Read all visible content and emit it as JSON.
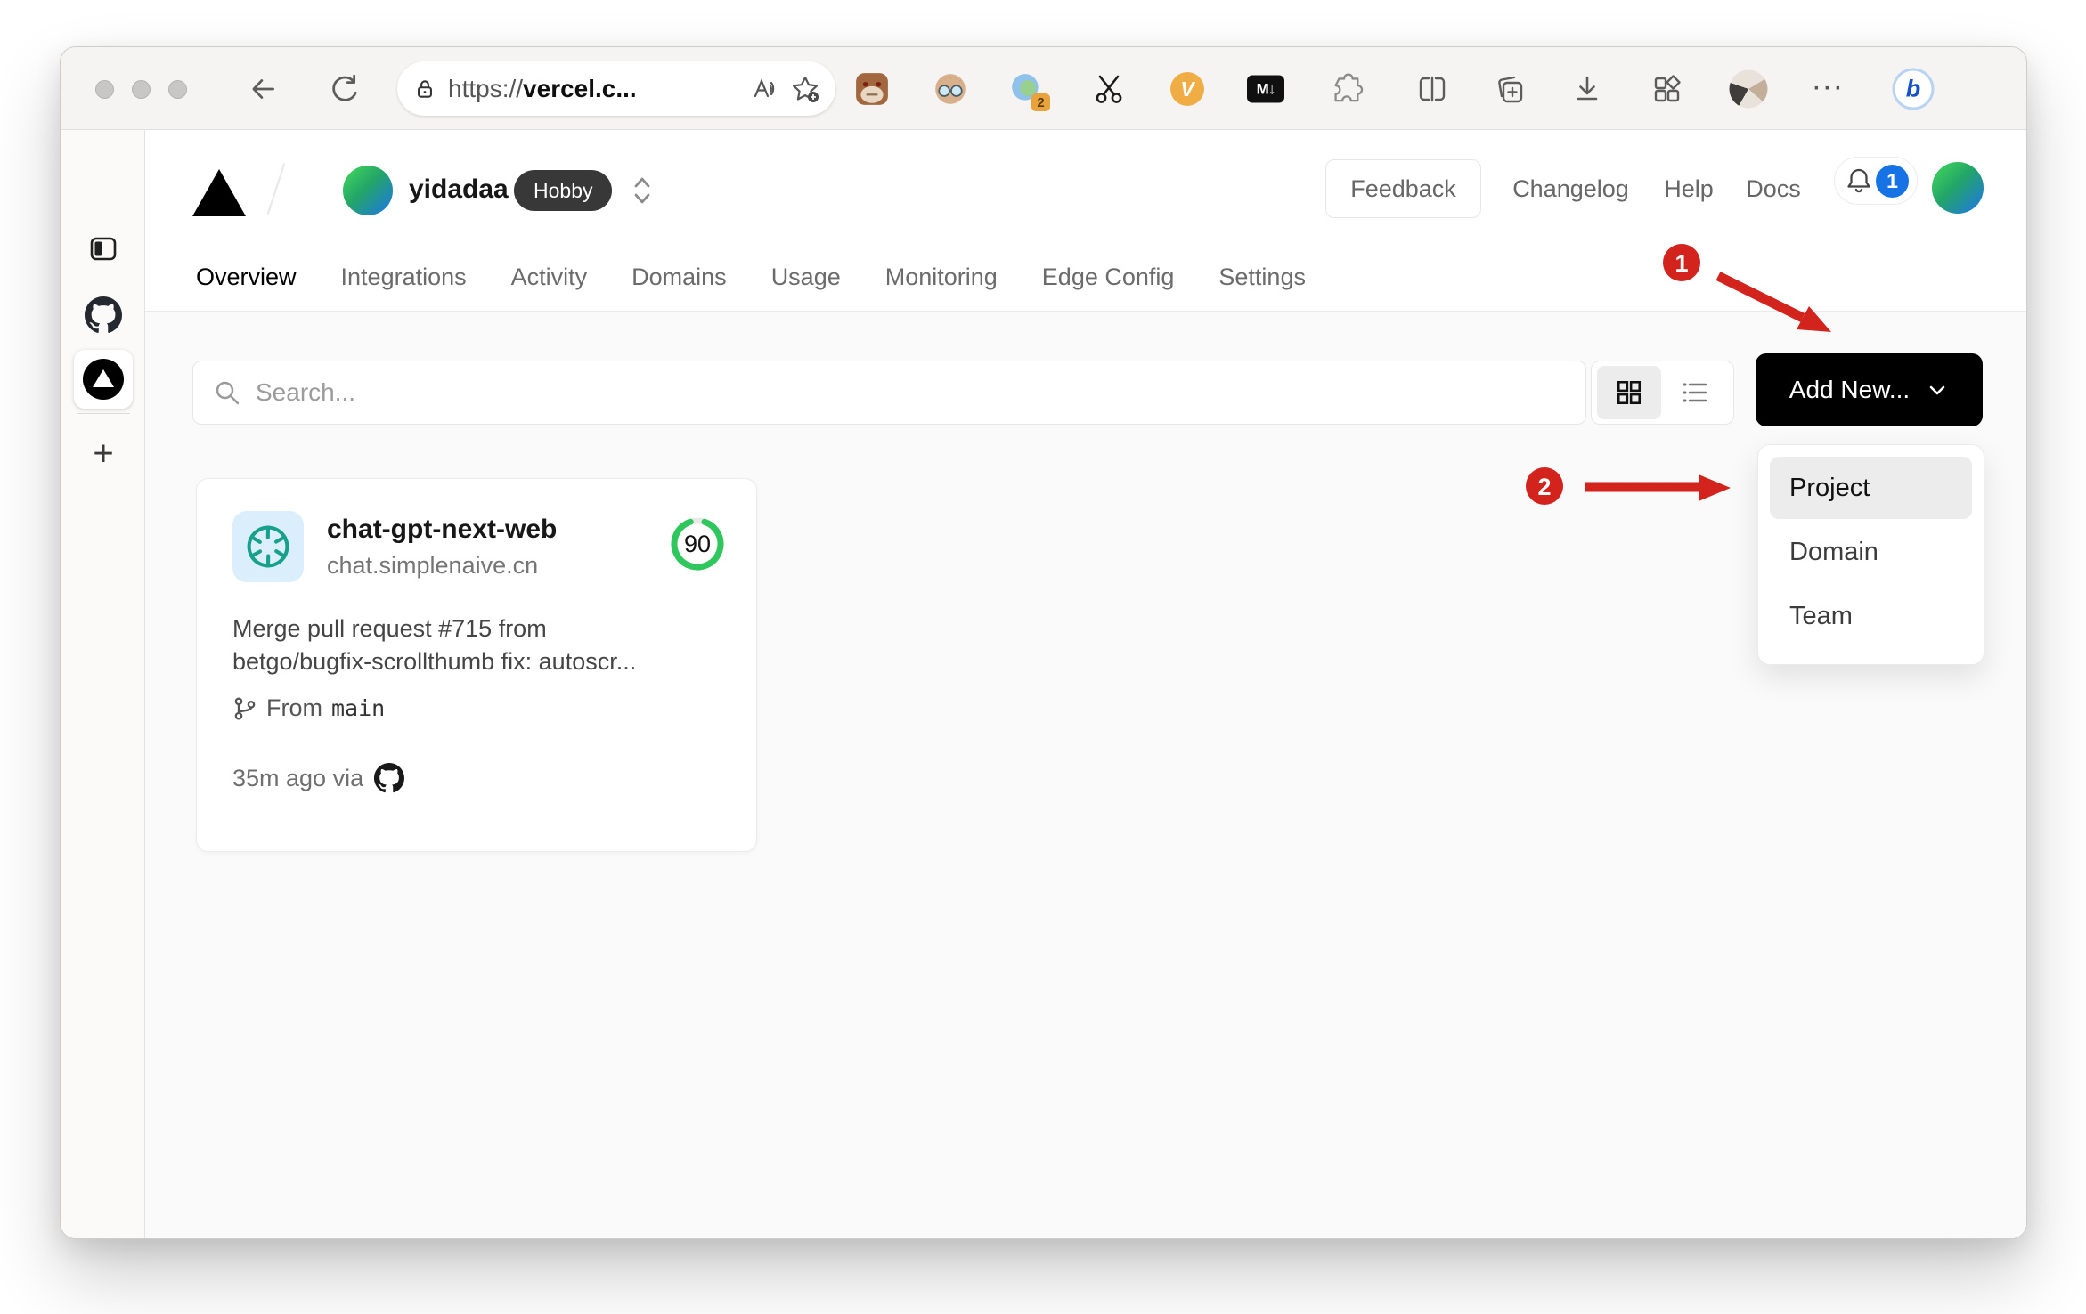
{
  "browser": {
    "url_scheme": "https://",
    "url_host": "vercel.c...",
    "extensions": {
      "proxy_badge": "2",
      "v_label": "V",
      "markdown_label": "M↓"
    },
    "more_glyph": "···",
    "bing_label": "b"
  },
  "sidebar": {
    "new_tab_glyph": "+"
  },
  "header": {
    "team_name": "yidadaa",
    "plan_badge": "Hobby",
    "feedback_label": "Feedback",
    "links": [
      {
        "label": "Changelog"
      },
      {
        "label": "Help"
      },
      {
        "label": "Docs"
      }
    ],
    "notification_count": "1"
  },
  "tabs": [
    {
      "label": "Overview",
      "active": true
    },
    {
      "label": "Integrations",
      "active": false
    },
    {
      "label": "Activity",
      "active": false
    },
    {
      "label": "Domains",
      "active": false
    },
    {
      "label": "Usage",
      "active": false
    },
    {
      "label": "Monitoring",
      "active": false
    },
    {
      "label": "Edge Config",
      "active": false
    },
    {
      "label": "Settings",
      "active": false
    }
  ],
  "content": {
    "search_placeholder": "Search...",
    "add_new_label": "Add New...",
    "dropdown": {
      "items": [
        {
          "label": "Project",
          "highlighted": true
        },
        {
          "label": "Domain",
          "highlighted": false
        },
        {
          "label": "Team",
          "highlighted": false
        }
      ]
    }
  },
  "project_card": {
    "name": "chat-gpt-next-web",
    "domain": "chat.simplenaive.cn",
    "score": "90",
    "score_percent": 90,
    "commit_line1": "Merge pull request #715 from",
    "commit_line2": "betgo/bugfix-scrollthumb fix: autoscr...",
    "branch_label": "From",
    "branch_name": "main",
    "deploy_meta": "35m ago via"
  },
  "annotations": {
    "step1": "1",
    "step2": "2"
  },
  "colors": {
    "annotation_red": "#d2231d",
    "accent_green": "#2fc65d",
    "badge_blue": "#1673e6",
    "openai_teal": "#17a08b",
    "hobby_badge_bg": "#383838"
  }
}
